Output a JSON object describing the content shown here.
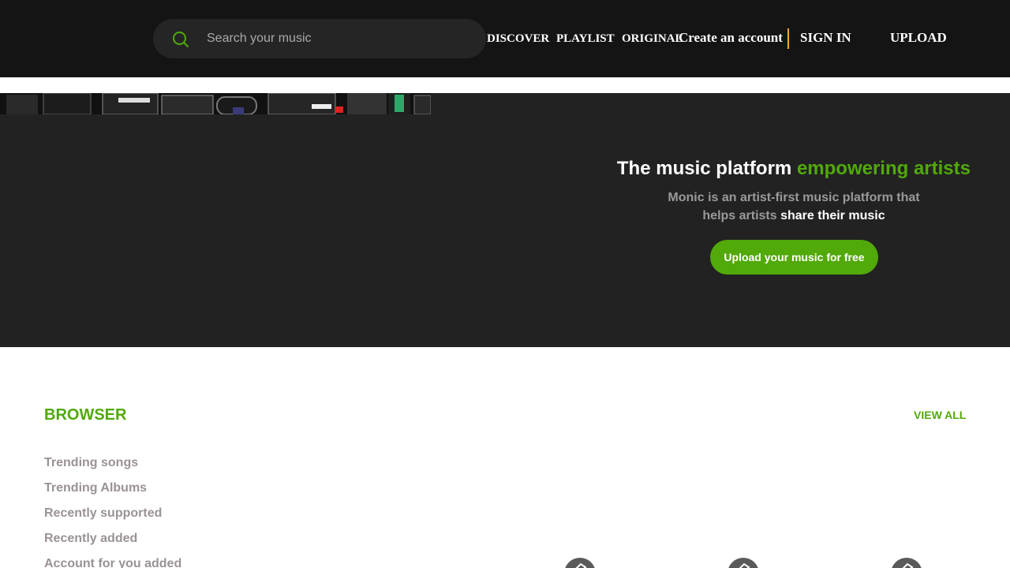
{
  "header": {
    "search": {
      "placeholder": "Search your music",
      "value": "",
      "icon": "search-icon"
    },
    "nav": {
      "discover": "DISCOVER",
      "playlist": "PLAYLIST",
      "original": "ORIGINAL",
      "create_account": "Create an account",
      "sign_in": "SIGN IN",
      "upload": "UPLOAD"
    }
  },
  "hero": {
    "title_plain": "The music platform ",
    "title_accent": "empowering artists",
    "subtitle_line1": "Monic is an artist-first music platform that",
    "subtitle_line2_plain": "helps artists ",
    "subtitle_line2_bold": "share their music",
    "cta": "Upload your music for free"
  },
  "browser": {
    "title": "BROWSER",
    "view_all": "VIEW ALL",
    "items": [
      "Trending songs",
      "Trending Albums",
      "Recently supported",
      "Recently added",
      "Account for you added"
    ]
  },
  "colors": {
    "accent": "#51a90a",
    "header_bg": "#141414",
    "hero_bg": "#222222"
  }
}
